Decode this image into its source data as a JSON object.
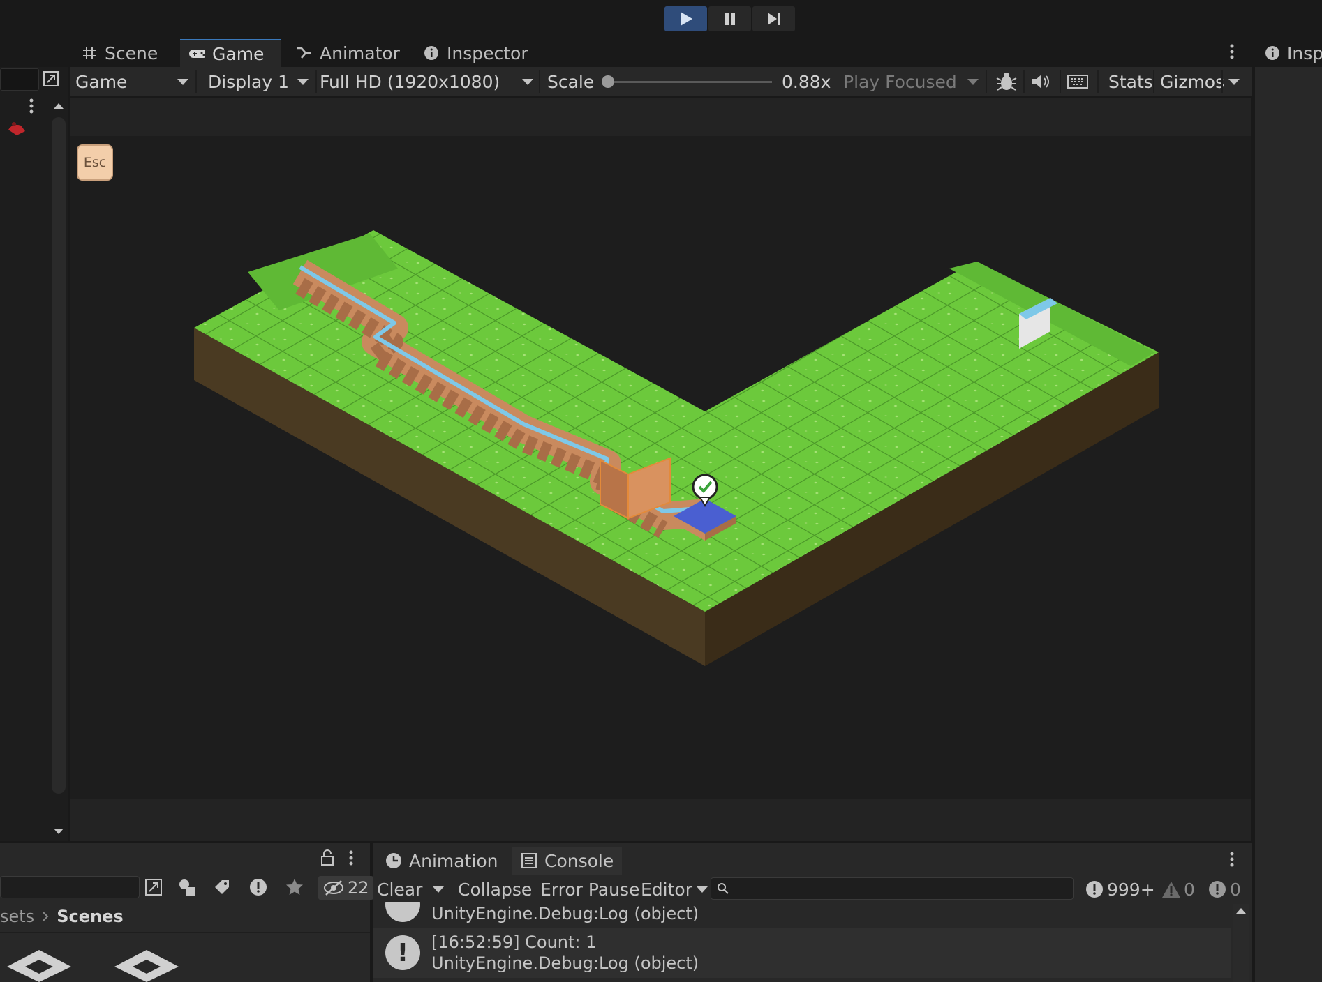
{
  "playbar": {
    "play_icon": "play-icon",
    "pause_icon": "pause-icon",
    "step_icon": "step-icon"
  },
  "tabs": {
    "scene": "Scene",
    "game": "Game",
    "animator": "Animator",
    "inspector": "Inspector",
    "inspector_right": "Inspe"
  },
  "game_toolbar": {
    "view_mode": "Game",
    "display": "Display 1",
    "resolution": "Full HD (1920x1080)",
    "scale_label": "Scale",
    "scale_value": "0.88x",
    "play_mode": "Play Focused",
    "stats": "Stats",
    "gizmos": "Gizmos",
    "scale_fraction": 0.0
  },
  "game": {
    "esc_label": "Esc"
  },
  "project": {
    "breadcrumb_prev": "sets",
    "breadcrumb_current": "Scenes",
    "hidden_count": "22"
  },
  "bottom_tabs": {
    "animation": "Animation",
    "console": "Console"
  },
  "console": {
    "clear": "Clear",
    "collapse": "Collapse",
    "error_pause": "Error Pause",
    "editor": "Editor",
    "search_placeholder": "",
    "log_count": "999+",
    "warn_count": "0",
    "error_count": "0",
    "logs": [
      {
        "line1": "",
        "line2": "UnityEngine.Debug:Log (object)"
      },
      {
        "line1": "[16:52:59] Count: 1",
        "line2": "UnityEngine.Debug:Log (object)"
      }
    ]
  },
  "colors": {
    "accent": "#3a79bb",
    "play_active": "#2f4c7a",
    "grass": "#6cc93c",
    "dirt": "#4a3a22",
    "brick": "#c98a5e",
    "water": "#7ec8e8",
    "tile_blue": "#4a5fd1"
  }
}
